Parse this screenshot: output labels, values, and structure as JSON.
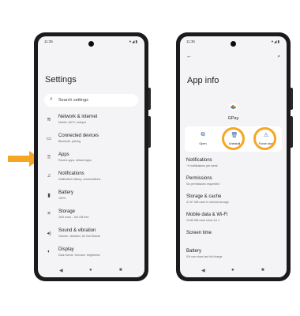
{
  "colors": {
    "highlight": "#f5a623",
    "screen_bg": "#f4f3f6",
    "accent": "#2b5ea8"
  },
  "left_phone": {
    "status": {
      "time": "11:35",
      "icons": "▾◢▮"
    },
    "title": "Settings",
    "search_placeholder": "Search settings",
    "items": [
      {
        "icon": "wifi-icon",
        "glyph": "≋",
        "title": "Network & internet",
        "subtitle": "Mobile, Wi-Fi, hotspot"
      },
      {
        "icon": "devices-icon",
        "glyph": "▭",
        "title": "Connected devices",
        "subtitle": "Bluetooth, pairing"
      },
      {
        "icon": "apps-icon",
        "glyph": "⠿",
        "title": "Apps",
        "subtitle": "Recent apps, default apps"
      },
      {
        "icon": "bell-icon",
        "glyph": "♫",
        "title": "Notifications",
        "subtitle": "Notification history, conversations"
      },
      {
        "icon": "battery-icon",
        "glyph": "▮",
        "title": "Battery",
        "subtitle": "100%"
      },
      {
        "icon": "storage-icon",
        "glyph": "≡",
        "title": "Storage",
        "subtitle": "18% used - 104 GB free"
      },
      {
        "icon": "volume-icon",
        "glyph": "◂)",
        "title": "Sound & vibration",
        "subtitle": "Volume, vibration, Do Not Disturb"
      },
      {
        "icon": "display-icon",
        "glyph": "◐",
        "title": "Display",
        "subtitle": "Dark theme, font size, brightness"
      }
    ],
    "nav": {
      "back": "◀",
      "home": "●",
      "recents": "■"
    }
  },
  "right_phone": {
    "status": {
      "time": "11:35",
      "icons": "▾◢▮"
    },
    "back_glyph": "←",
    "search_glyph": "⌕",
    "title": "App info",
    "app_name": "GPay",
    "actions": [
      {
        "icon": "open-icon",
        "glyph": "⧉",
        "label": "Open"
      },
      {
        "icon": "trash-icon",
        "glyph": "🗑",
        "label": "Uninstall"
      },
      {
        "icon": "warning-icon",
        "glyph": "⚠",
        "label": "Force stop"
      }
    ],
    "rows": [
      {
        "title": "Notifications",
        "subtitle": "~0 notifications per week"
      },
      {
        "title": "Permissions",
        "subtitle": "No permissions requested"
      },
      {
        "title": "Storage & cache",
        "subtitle": "47.67 MB used in internal storage"
      },
      {
        "title": "Mobile data & Wi-Fi",
        "subtitle": "10.89 MB used since Jul 1"
      },
      {
        "title": "Screen time",
        "subtitle": ""
      },
      {
        "title": "Battery",
        "subtitle": "0% use since last full charge"
      }
    ],
    "nav": {
      "back": "◀",
      "home": "●",
      "recents": "■"
    }
  }
}
